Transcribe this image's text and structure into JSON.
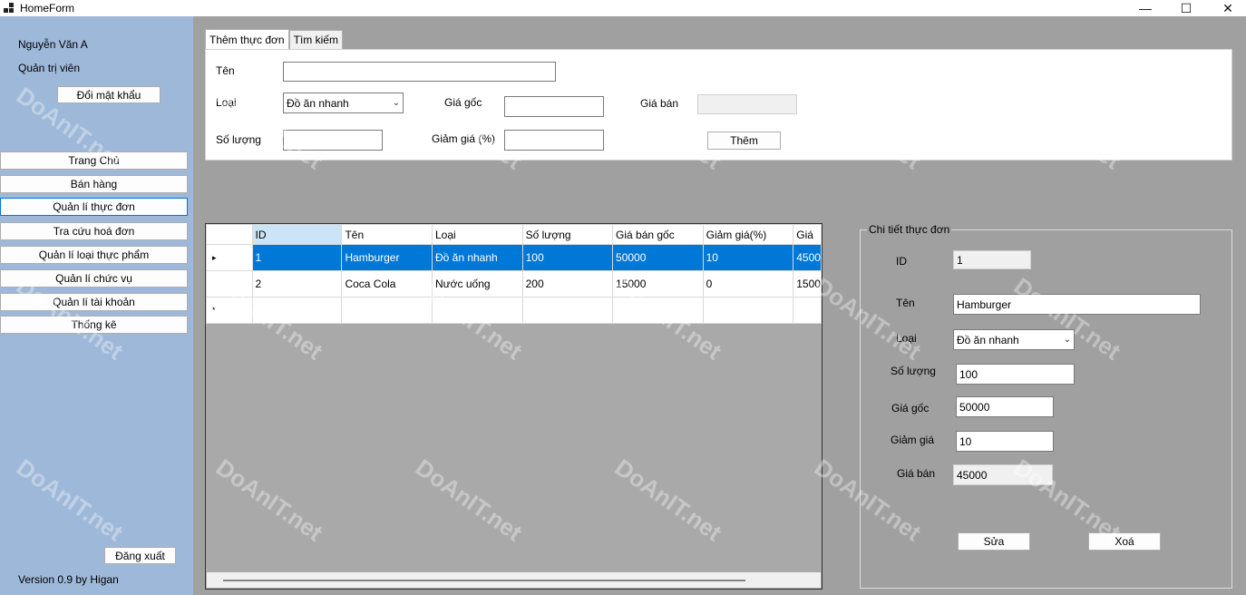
{
  "window": {
    "title": "HomeForm",
    "minimize": "—",
    "maximize": "☐",
    "close": "✕"
  },
  "sidebar": {
    "user_name": "Nguyễn Văn A",
    "role": "Quản trị viên",
    "change_password": "Đổi mật khẩu",
    "nav": [
      "Trang Chủ",
      "Bán hàng",
      "Quản lí thực đơn",
      "Tra cứu hoá đơn",
      "Quản lí loại thực phẩm",
      "Quản lí chức vụ",
      "Quản lí tài khoản",
      "Thống kê"
    ],
    "active_nav": "Quản lí thực đơn",
    "logout": "Đăng xuất",
    "version": "Version 0.9 by Higan"
  },
  "tabs": [
    "Thêm thực đơn",
    "Tìm kiếm"
  ],
  "add_form": {
    "name_label": "Tên",
    "name_value": "",
    "type_label": "Loại",
    "type_value": "Đồ ăn nhanh",
    "base_price_label": "Giá gốc",
    "base_price_value": "",
    "sale_price_label": "Giá bán",
    "sale_price_value": "",
    "qty_label": "Số lượng",
    "qty_value": "",
    "discount_label": "Giảm giá (%)",
    "discount_value": "",
    "add_button": "Thêm"
  },
  "grid": {
    "columns": [
      "ID",
      "Tên",
      "Loại",
      "Số lượng",
      "Giá bán gốc",
      "Giảm giá(%)",
      "Giá"
    ],
    "rows": [
      [
        "1",
        "Hamburger",
        "Đồ ăn nhanh",
        "100",
        "50000",
        "10",
        "4500"
      ],
      [
        "2",
        "Coca Cola",
        "Nước uống",
        "200",
        "15000",
        "0",
        "1500"
      ]
    ],
    "selected_row_marker": "▸",
    "new_row_marker": "*"
  },
  "detail": {
    "title": "Chi tiết thực đơn",
    "id_label": "ID",
    "id_value": "1",
    "name_label": "Tên",
    "name_value": "Hamburger",
    "type_label": "Loại",
    "type_value": "Đồ ăn nhanh",
    "qty_label": "Số lượng",
    "qty_value": "100",
    "base_price_label": "Giá gốc",
    "base_price_value": "50000",
    "discount_label": "Giảm giá",
    "discount_value": "10",
    "sale_price_label": "Giá bán",
    "sale_price_value": "45000",
    "edit_button": "Sửa",
    "delete_button": "Xoá"
  },
  "watermark": "DoAnIT.net"
}
